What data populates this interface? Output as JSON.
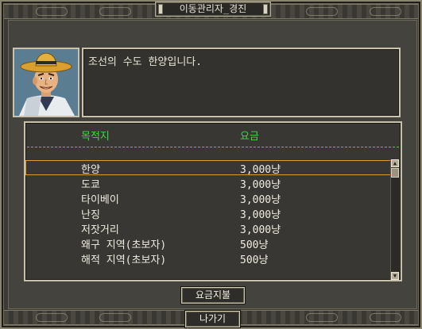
{
  "window": {
    "title": "이동관리자_경진"
  },
  "npc": {
    "dialogue": "조선의 수도 한양입니다."
  },
  "destinations": {
    "header_destination": "목적지",
    "header_fee": "요금",
    "rows": [
      {
        "name": "한양",
        "fee": "3,000냥"
      },
      {
        "name": "도쿄",
        "fee": "3,000냥"
      },
      {
        "name": "타이베이",
        "fee": "3,000냥"
      },
      {
        "name": "난징",
        "fee": "3,000냥"
      },
      {
        "name": "저잣거리",
        "fee": "3,000냥"
      },
      {
        "name": "왜구 지역(초보자)",
        "fee": "500냥"
      },
      {
        "name": "해적 지역(초보자)",
        "fee": "500냥"
      }
    ],
    "selected_index": 0
  },
  "buttons": {
    "pay_label": "요금지불",
    "exit_label": "나가기"
  },
  "icons": {
    "scroll_up": "scroll-up-arrow-icon",
    "scroll_down": "scroll-down-arrow-icon"
  },
  "colors": {
    "header_text": "#3fd93f",
    "selection_outline": "#d79b35",
    "row_text": "#f0ece0"
  }
}
